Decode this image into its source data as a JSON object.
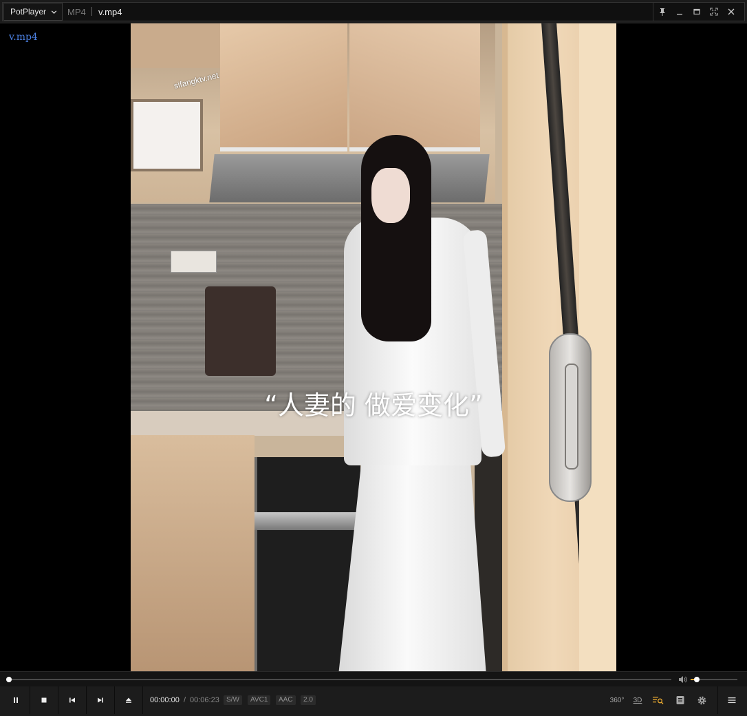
{
  "window": {
    "app_menu_label": "PotPlayer",
    "format_label": "MP4",
    "file_title": "v.mp4"
  },
  "title_buttons": [
    "pin-icon",
    "minimize-icon",
    "maximize-icon",
    "fullscreen-icon",
    "close-icon"
  ],
  "osd": {
    "filename": "v.mp4"
  },
  "video": {
    "caption": "“人妻的 做爱变化”",
    "watermark": "sifangktv.net"
  },
  "playback": {
    "current_time": "00:00:00",
    "separator": "/",
    "duration": "00:06:23",
    "position_fraction": 0.0,
    "volume_fraction": 0.13
  },
  "badges": [
    "S/W",
    "AVC1",
    "AAC",
    "2.0"
  ],
  "controls_left": [
    "pause-icon",
    "stop-icon",
    "previous-icon",
    "next-icon",
    "eject-icon"
  ],
  "controls_right": {
    "vr_label": "360°",
    "threeD_label": "3D",
    "icons": [
      "playlist-search-icon",
      "chapter-icon",
      "settings-icon",
      "menu-icon"
    ]
  },
  "colors": {
    "accent": "#e8a930",
    "osd_text": "#4b7fe0"
  }
}
